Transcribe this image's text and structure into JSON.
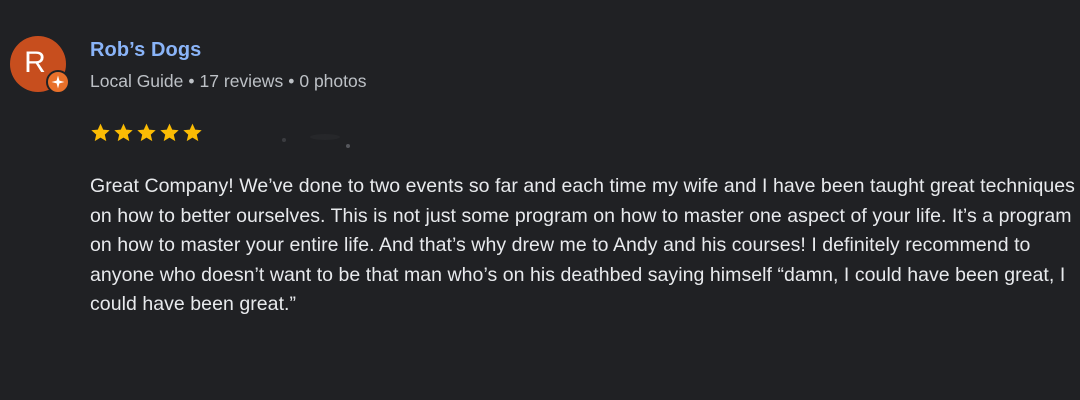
{
  "review": {
    "avatar_letter": "R",
    "author_name": "Rob’s Dogs",
    "author_level": "Local Guide",
    "review_count": "17 reviews",
    "photo_count": "0 photos",
    "meta_separator": "•",
    "rating": 5,
    "rating_max": 5,
    "text": "Great Company! We’ve done to two events so far and each time my wife and I have been taught great techniques on how to better ourselves. This is not just some program on how to master one aspect of your life. It’s a program on how to master your entire life. And that’s why drew me to Andy and his courses! I definitely recommend to anyone who doesn’t want to be that man who’s on his deathbed saying himself “damn, I could have been great, I could have been great.”"
  },
  "colors": {
    "background": "#202124",
    "author_name": "#8ab4f8",
    "avatar": "#c74e1e",
    "badge": "#e8702a",
    "star": "#fbbc04",
    "meta_text": "#bdc1c6",
    "body_text": "#e8eaed"
  },
  "icons": {
    "badge": "local-guide-badge-icon",
    "star": "star-icon"
  }
}
